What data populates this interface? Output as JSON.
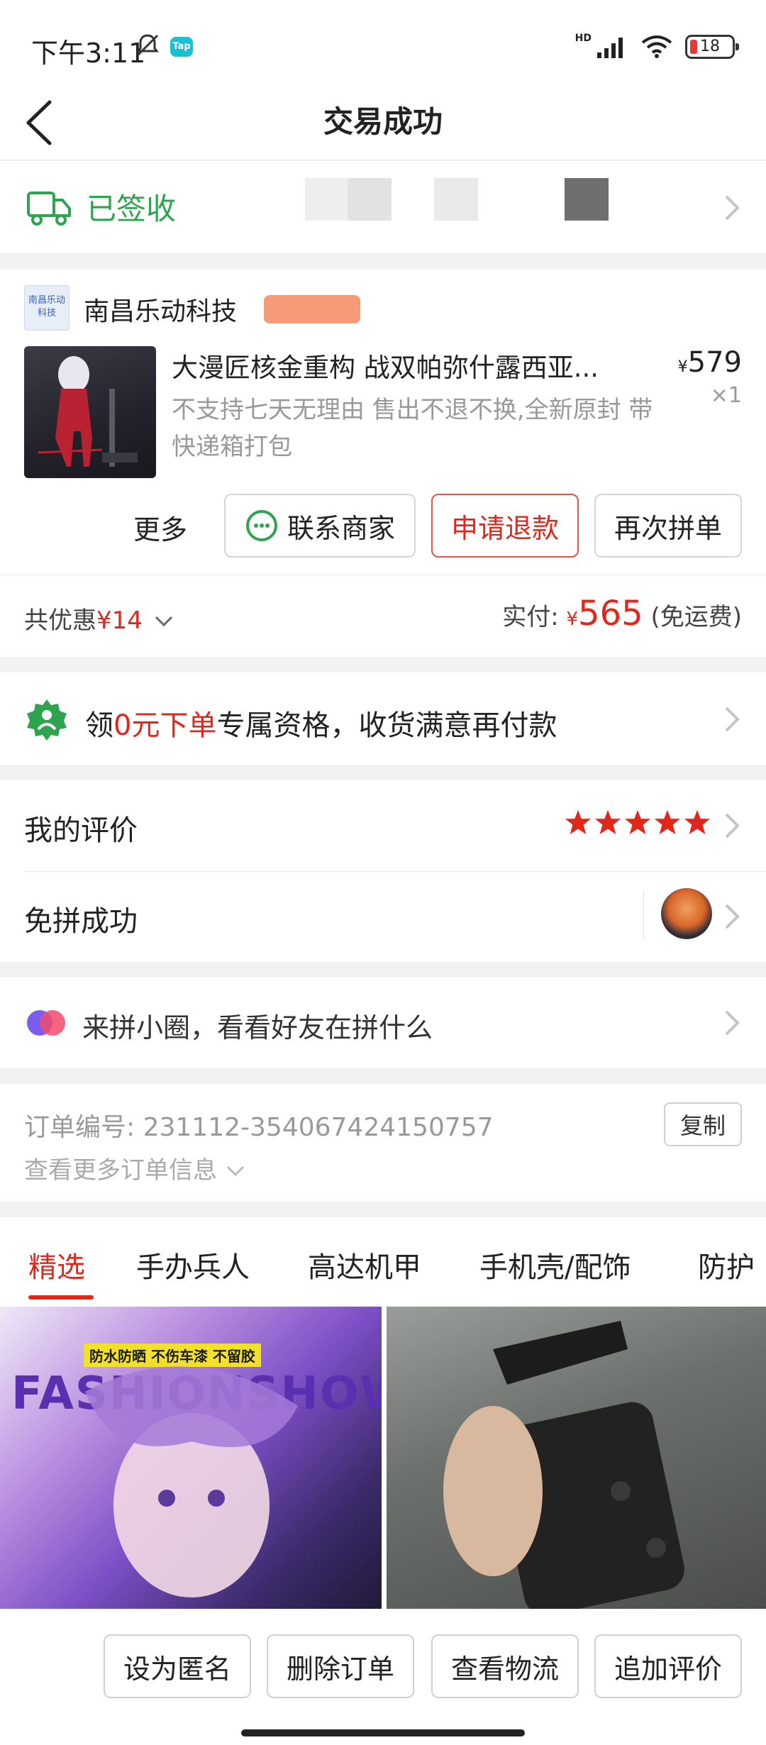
{
  "status_bar": {
    "time": "下午3:11",
    "app_badge": "Tap",
    "network": "HD",
    "battery": "18"
  },
  "header": {
    "title": "交易成功"
  },
  "logistics": {
    "status": "已签收"
  },
  "order": {
    "shop_logo_text": "南昌乐动科技",
    "shop_name": "南昌乐动科技",
    "product_title": "大漫匠核金重构 战双帕弥什露西亚...",
    "product_desc": "不支持七天无理由 售出不退不换,全新原封 带快递箱打包",
    "price_symbol": "¥",
    "price": "579",
    "quantity": "×1",
    "more_label": "更多",
    "contact_label": "联系商家",
    "refund_label": "申请退款",
    "rebuy_label": "再次拼单"
  },
  "summary": {
    "discount_prefix": "共优惠",
    "discount_amount": "¥14",
    "paid_label": "实付:",
    "paid_symbol": "¥",
    "paid_amount": "565",
    "shipping_note": "(免运费)"
  },
  "promo": {
    "prefix": "领",
    "highlight": "0元下单",
    "suffix": "专属资格，收货满意再付款"
  },
  "review": {
    "my_review_label": "我的评价",
    "stars": 5,
    "group_label": "免拼成功"
  },
  "circle": {
    "text": "来拼小圈，看看好友在拼什么"
  },
  "order_info": {
    "order_no_label": "订单编号:",
    "order_no": "231112-354067424150757",
    "copy_label": "复制",
    "more_info_label": "查看更多订单信息"
  },
  "tabs": [
    "精选",
    "手办兵人",
    "高达机甲",
    "手机壳/配饰",
    "防护"
  ],
  "feed": {
    "left_badge": "防水防晒 不伤车漆 不留胶",
    "left_headline": "FASHIONSHOW"
  },
  "bottom_bar": {
    "anonymous_label": "设为匿名",
    "delete_label": "删除订单",
    "logistics_label": "查看物流",
    "append_review_label": "追加评价"
  },
  "colors": {
    "accent_red": "#e0271c",
    "success_green": "#2ea44f"
  }
}
